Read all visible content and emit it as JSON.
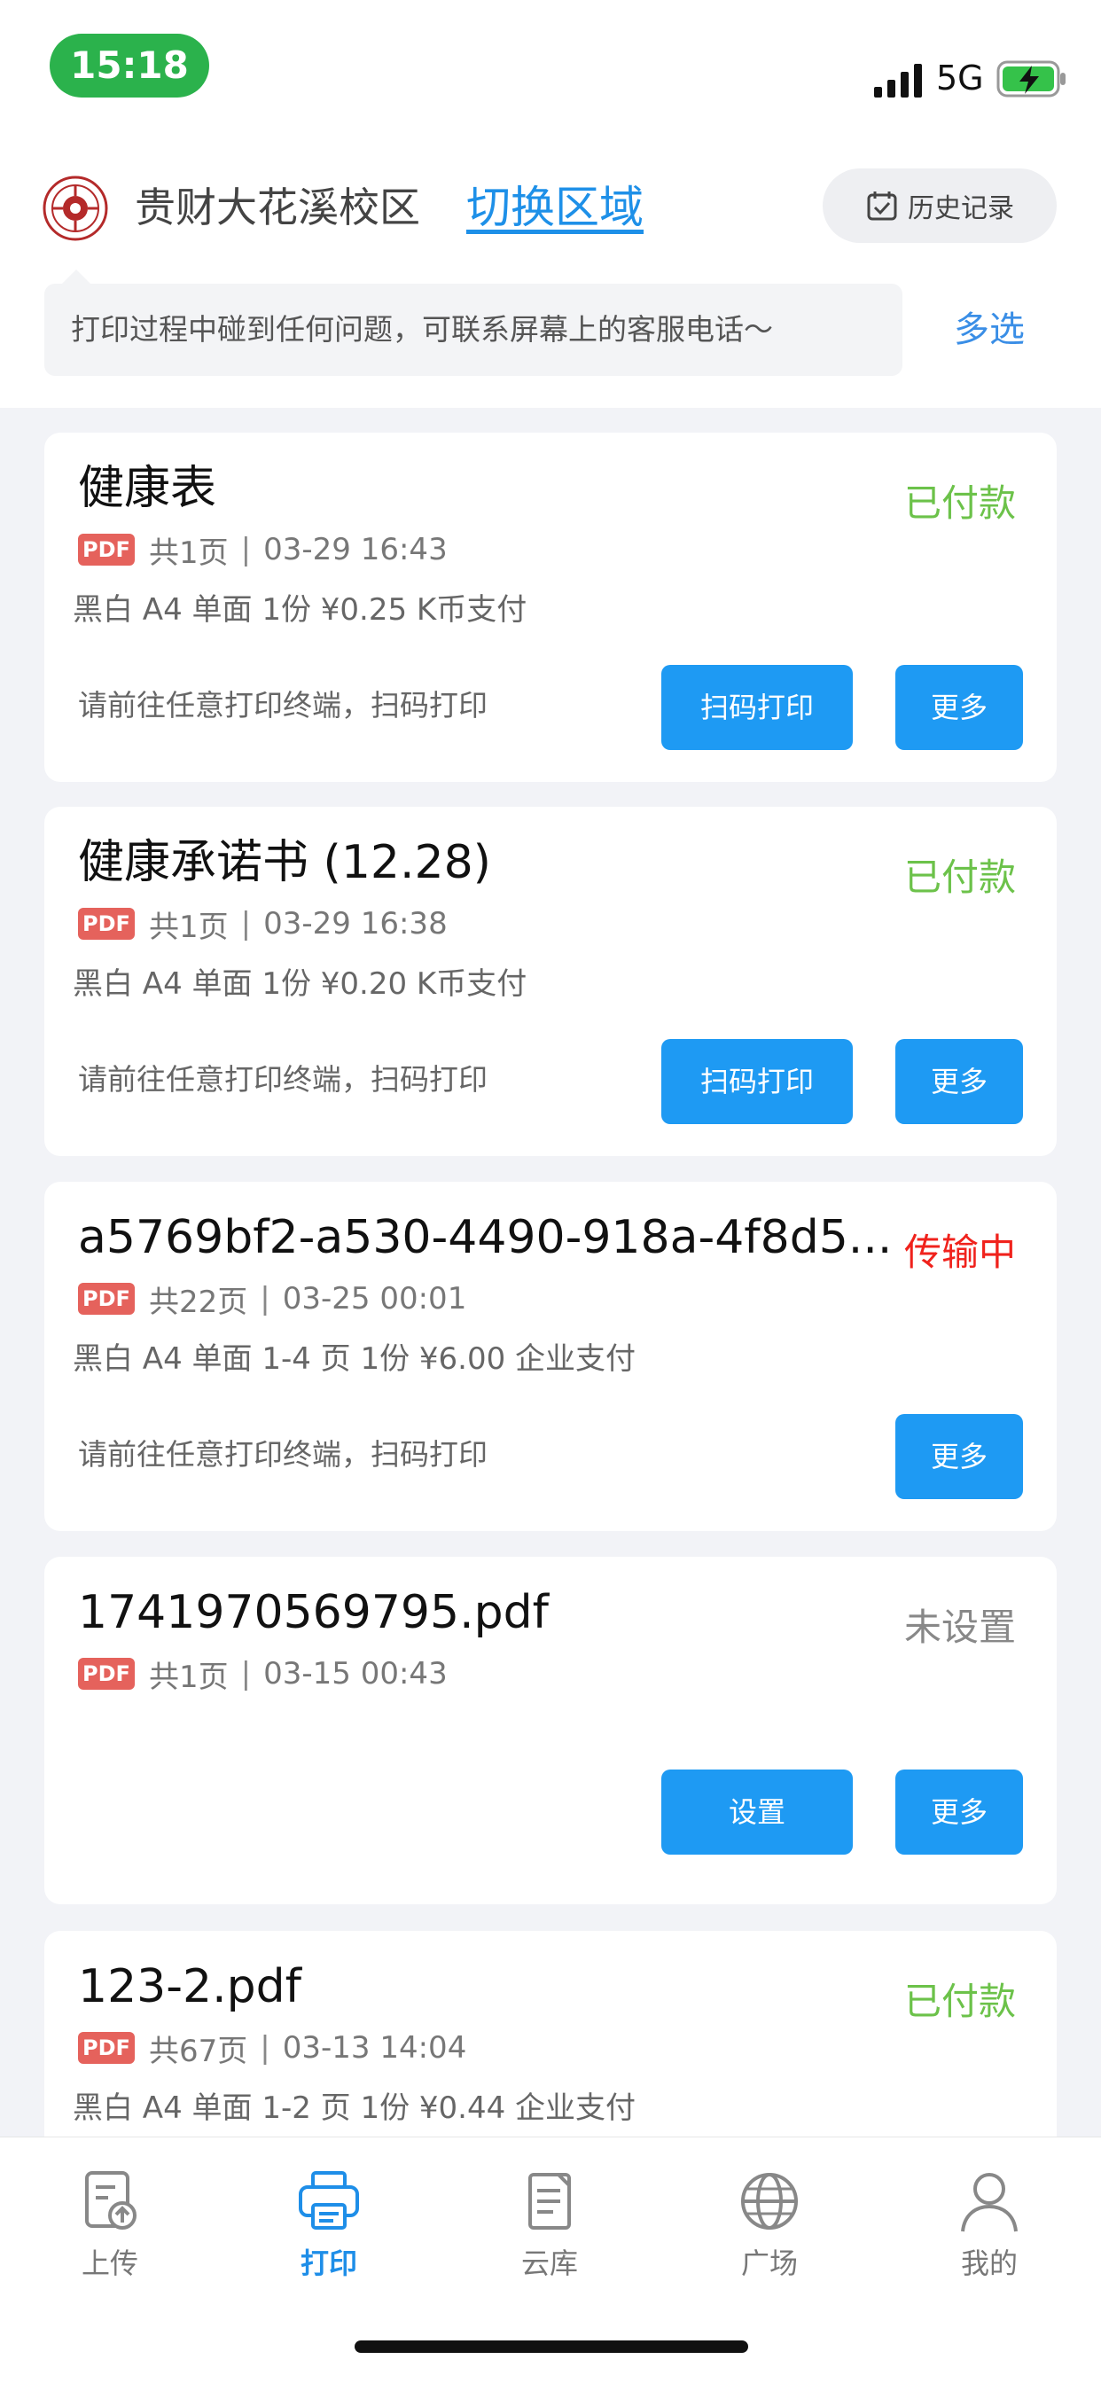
{
  "status_bar": {
    "time": "15:18",
    "network": "5G"
  },
  "header": {
    "campus_name": "贵财大花溪校区",
    "switch_label": "切换区域",
    "history_label": "历史记录",
    "notice": "打印过程中碰到任何问题，可联系屏幕上的客服电话～",
    "multi_select_label": "多选"
  },
  "status_colors": {
    "paid": "#6cc24a",
    "transferring": "#f0221c",
    "unset": "#888888"
  },
  "jobs": [
    {
      "title": "健康表",
      "status": "已付款",
      "file_type": "PDF",
      "pages": "共1页",
      "time": "03-29 16:43",
      "details": "黑白 A4 单面 1份 ¥0.25  K币支付",
      "hint": "请前往任意打印终端，扫码打印",
      "primary_action": "扫码打印",
      "more_label": "更多"
    },
    {
      "title": "健康承诺书 (12.28)",
      "status": "已付款",
      "file_type": "PDF",
      "pages": "共1页",
      "time": "03-29 16:38",
      "details": "黑白 A4 单面 1份 ¥0.20  K币支付",
      "hint": "请前往任意打印终端，扫码打印",
      "primary_action": "扫码打印",
      "more_label": "更多"
    },
    {
      "title": "a5769bf2-a530-4490-918a-4f8d5...",
      "status": "传输中",
      "file_type": "PDF",
      "pages": "共22页",
      "time": "03-25 00:01",
      "details": "黑白 A4 单面 1-4 页 1份 ¥6.00  企业支付",
      "hint": "请前往任意打印终端，扫码打印",
      "more_label": "更多"
    },
    {
      "title": "1741970569795.pdf",
      "status": "未设置",
      "file_type": "PDF",
      "pages": "共1页",
      "time": "03-15 00:43",
      "primary_action": "设置",
      "more_label": "更多"
    },
    {
      "title": "123-2.pdf",
      "status": "已付款",
      "file_type": "PDF",
      "pages": "共67页",
      "time": "03-13 14:04",
      "details": "黑白 A4 单面 1-2 页 1份 ¥0.44  企业支付"
    }
  ],
  "tabs": [
    {
      "label": "上传",
      "icon": "upload-icon",
      "active": false
    },
    {
      "label": "打印",
      "icon": "printer-icon",
      "active": true
    },
    {
      "label": "云库",
      "icon": "cloud-library-icon",
      "active": false
    },
    {
      "label": "广场",
      "icon": "globe-icon",
      "active": false
    },
    {
      "label": "我的",
      "icon": "profile-icon",
      "active": false
    }
  ]
}
